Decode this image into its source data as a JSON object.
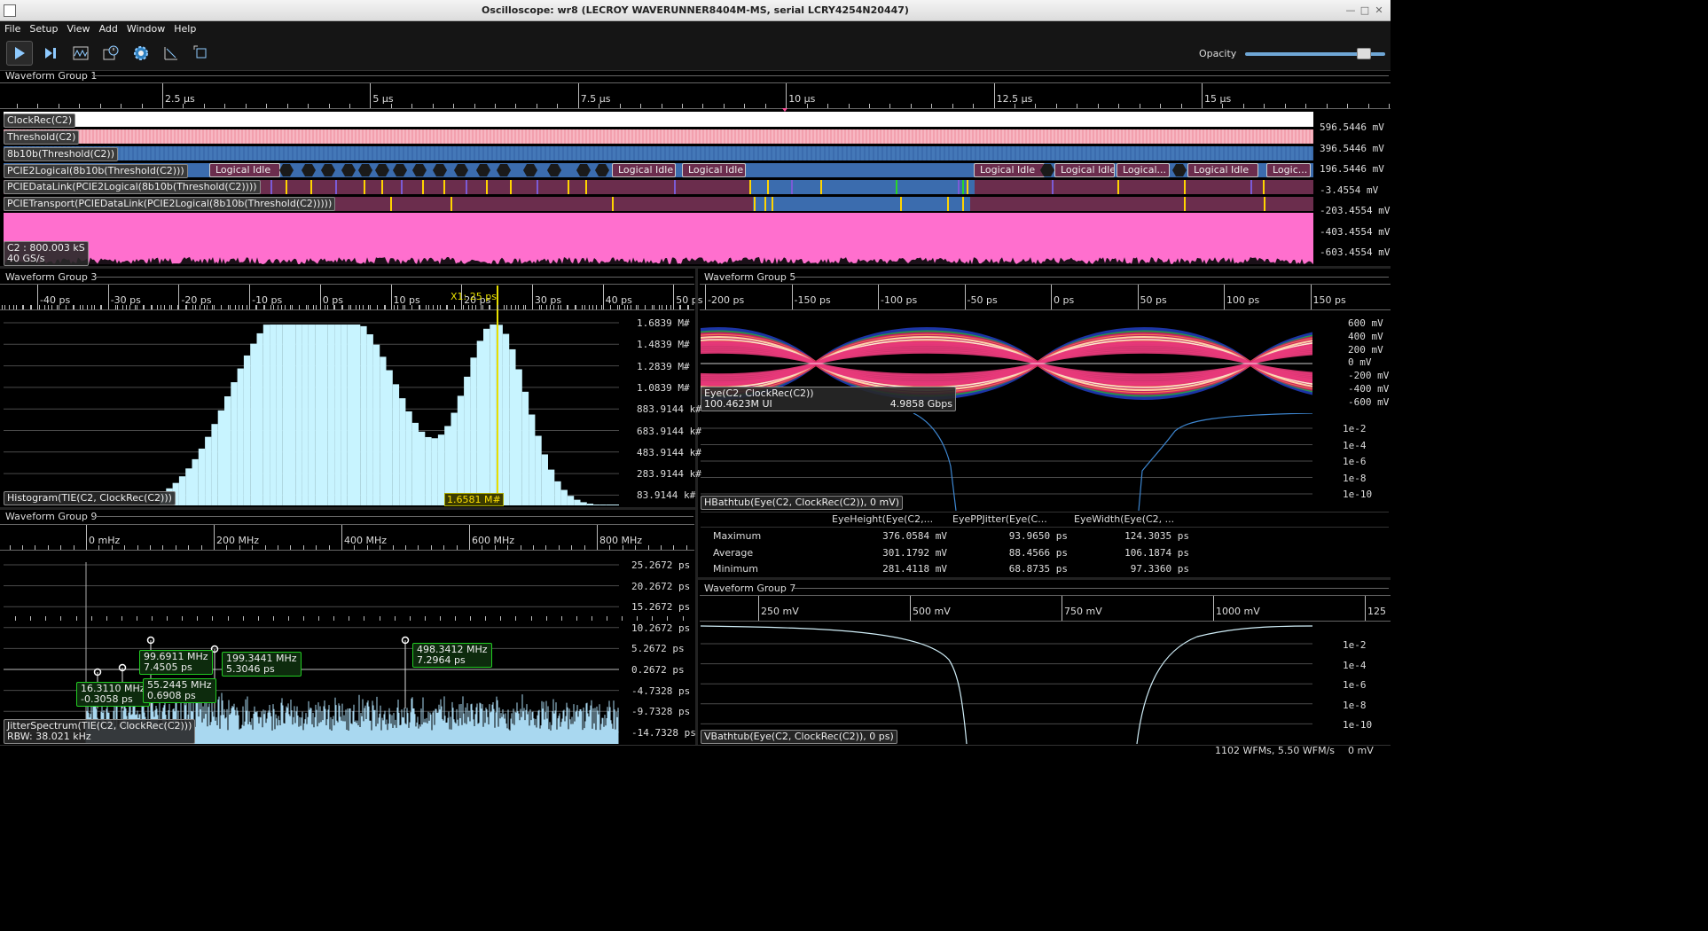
{
  "window": {
    "title": "Oscilloscope: wr8 (LECROY WAVERUNNER8404M-MS, serial LCRY4254N20447)"
  },
  "menu": [
    "File",
    "Setup",
    "View",
    "Add",
    "Window",
    "Help"
  ],
  "toolbar": {
    "buttons": [
      "play-icon",
      "step-icon",
      "waveform-icon",
      "history-icon",
      "settings-icon",
      "measure-icon",
      "fullscreen-icon"
    ],
    "opacity_label": "Opacity",
    "opacity_value": 0.85
  },
  "group1": {
    "title": "Waveform Group 1",
    "ticks": [
      "2.5 µs",
      "5 µs",
      "7.5 µs",
      "10 µs",
      "12.5 µs",
      "15 µs"
    ],
    "lanes": [
      "ClockRec(C2)",
      "Threshold(C2)",
      "8b10b(Threshold(C2))",
      "PCIE2Logical(8b10b(Threshold(C2)))",
      "PCIEDataLink(PCIE2Logical(8b10b(Threshold(C2))))",
      "PCIETransport(PCIEDataLink(PCIE2Logical(8b10b(Threshold(C2)))))"
    ],
    "logical_idle": [
      "Logical Idle",
      "Logical Idle",
      "Logical Idle",
      "Logical Idle",
      "Logical Idle",
      "Logical...",
      "Logical Idle",
      "Logic..."
    ],
    "channel_label": "C2 : 800.003 kS",
    "rate_label": "40 GS/s",
    "volt_labels": [
      "596.5446 mV",
      "396.5446 mV",
      "196.5446 mV",
      "-3.4554 mV",
      "-203.4554 mV",
      "-403.4554 mV",
      "-603.4554 mV"
    ]
  },
  "group3": {
    "title": "Waveform Group 3",
    "ticks": [
      "-40 ps",
      "-30 ps",
      "-20 ps",
      "-10 ps",
      "0 ps",
      "10 ps",
      "20 ps",
      "30 ps",
      "40 ps",
      "50 ps"
    ],
    "cursor_label": "X1: 25 ps",
    "cursor_value": "1.6581 M#",
    "y_labels": [
      "1.6839 M#",
      "1.4839 M#",
      "1.2839 M#",
      "1.0839 M#",
      "883.9144 k#",
      "683.9144 k#",
      "483.9144 k#",
      "283.9144 k#",
      "83.9144 k#"
    ],
    "trace_label": "Histogram(TIE(C2, ClockRec(C2)))"
  },
  "group9": {
    "title": "Waveform Group 9",
    "ticks": [
      "0 mHz",
      "200 MHz",
      "400 MHz",
      "600 MHz",
      "800 MHz"
    ],
    "y_labels": [
      "25.2672 ps",
      "20.2672 ps",
      "15.2672 ps",
      "10.2672 ps",
      "5.2672 ps",
      "0.2672 ps",
      "-4.7328 ps",
      "-9.7328 ps",
      "-14.7328 ps"
    ],
    "peaks": [
      {
        "line1": "16.3110 MHz",
        "line2": "-0.3058 ps"
      },
      {
        "line1": "99.6911 MHz",
        "line2": "7.4505 ps"
      },
      {
        "line1": "55.2445 MHz",
        "line2": "0.6908 ps"
      },
      {
        "line1": "199.3441 MHz",
        "line2": "5.3046 ps"
      },
      {
        "line1": "498.3412 MHz",
        "line2": "7.2964 ps"
      }
    ],
    "trace_label": "JitterSpectrum(TIE(C2, ClockRec(C2)))",
    "rbw_label": "RBW: 38.021 kHz"
  },
  "group5": {
    "title": "Waveform Group 5",
    "ticks": [
      "-200 ps",
      "-150 ps",
      "-100 ps",
      "-50 ps",
      "0 ps",
      "50 ps",
      "100 ps",
      "150 ps"
    ],
    "eye_y": [
      "600 mV",
      "400 mV",
      "200 mV",
      "0 mV",
      "-200 mV",
      "-400 mV",
      "-600 mV"
    ],
    "eye_label": "Eye(C2, ClockRec(C2))",
    "eye_ui": "100.4623M UI",
    "eye_rate": "4.9858 Gbps",
    "ber_y": [
      "1e-2",
      "1e-4",
      "1e-6",
      "1e-8",
      "1e-10"
    ],
    "bathtub_label": "HBathtub(Eye(C2, ClockRec(C2)), 0 mV)"
  },
  "stats": {
    "headers": [
      "EyeHeight(Eye(C2,...",
      "EyePPJitter(Eye(C...",
      "EyeWidth(Eye(C2, ..."
    ],
    "rows": [
      {
        "name": "Maximum",
        "v1": "376.0584 mV",
        "v2": "93.9650 ps",
        "v3": "124.3035 ps"
      },
      {
        "name": "Average",
        "v1": "301.1792 mV",
        "v2": "88.4566 ps",
        "v3": "106.1874 ps"
      },
      {
        "name": "Minimum",
        "v1": "281.4118 mV",
        "v2": "68.8735 ps",
        "v3": "97.3360 ps"
      }
    ]
  },
  "group7": {
    "title": "Waveform Group 7",
    "ticks": [
      "250 mV",
      "500 mV",
      "750 mV",
      "1000 mV",
      "125"
    ],
    "ber_y": [
      "1e-2",
      "1e-4",
      "1e-6",
      "1e-8",
      "1e-10"
    ],
    "bathtub_label": "VBathtub(Eye(C2, ClockRec(C2)), 0 ps)"
  },
  "status": {
    "wfms": "1102 WFMs, 5.50 WFM/s",
    "mv": "0 mV"
  },
  "colors": {
    "lane_white": "#ffffff",
    "lane_pink": "#f6a7b4",
    "lane_blue": "#3d6fb0",
    "lane_mauve": "#6b2d4d",
    "analog": "#ff6fce",
    "histogram": "#c8f4ff",
    "cursor": "#e8e000",
    "bubble": "#22cc22"
  }
}
